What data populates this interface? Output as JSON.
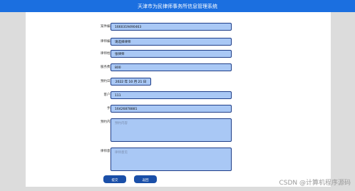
{
  "header": {
    "title": "天津市为民律师事务所信息管理系统"
  },
  "form": {
    "fields": [
      {
        "label": "案件编号",
        "value": "1660319490463"
      },
      {
        "label": "律师编号",
        "value": "请选择律师"
      },
      {
        "label": "律师姓名",
        "value": "张律师"
      },
      {
        "label": "服务费用",
        "value": "800"
      },
      {
        "label": "预约日期",
        "value": "2022 年 10 月 21 日"
      },
      {
        "label": "客户名",
        "value": "111"
      },
      {
        "label": "手机",
        "value": "16426878881"
      },
      {
        "label": "预约内容",
        "value": ""
      },
      {
        "label": "律师意见",
        "value": ""
      }
    ],
    "placeholders": {
      "content": "预约内容",
      "advice": "律师意见"
    }
  },
  "buttons": {
    "submit": "提交",
    "cancel": "返回"
  },
  "watermark": "CSDN @计算机程序源码"
}
